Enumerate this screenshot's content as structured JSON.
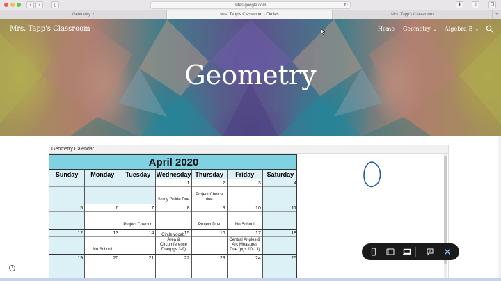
{
  "browser": {
    "url": "sites.google.com",
    "tabs": [
      "Geometry 2",
      "Mrs. Tapp's Classroom - Circles",
      "Mrs. Tapp's Classroom"
    ],
    "new_tab": "+"
  },
  "site": {
    "title": "Mrs. Tapp's Classroom",
    "nav": {
      "home": "Home",
      "geometry": "Geometry",
      "algebra": "Algebra B"
    },
    "hero_title": "Geometry"
  },
  "embed": {
    "title": "Geometry Calendar"
  },
  "calendar": {
    "month": "April 2020",
    "days": [
      "Sunday",
      "Monday",
      "Tuesday",
      "Wednesday",
      "Thursday",
      "Friday",
      "Saturday"
    ],
    "weeks": [
      [
        {
          "n": "",
          "e": ""
        },
        {
          "n": "",
          "e": ""
        },
        {
          "n": "",
          "e": ""
        },
        {
          "n": "1",
          "e": "Study Guide Due"
        },
        {
          "n": "2",
          "e": "Project Choice due"
        },
        {
          "n": "3",
          "e": ""
        },
        {
          "n": "4",
          "e": ""
        }
      ],
      [
        {
          "n": "5",
          "e": ""
        },
        {
          "n": "6",
          "e": ""
        },
        {
          "n": "7",
          "e": "Project Checkin"
        },
        {
          "n": "8",
          "e": ""
        },
        {
          "n": "9",
          "e": "Project Due"
        },
        {
          "n": "10",
          "e": "No School"
        },
        {
          "n": "11",
          "e": ""
        }
      ],
      [
        {
          "n": "12",
          "e": ""
        },
        {
          "n": "13",
          "e": "No School"
        },
        {
          "n": "14",
          "e": ""
        },
        {
          "n": "15",
          "e": "Circle vocab, Area & Circumference Due(pgs 3-9)"
        },
        {
          "n": "16",
          "e": ""
        },
        {
          "n": "17",
          "e": "Central Angles & Arc Measures Due (pgs 10-13)"
        },
        {
          "n": "18",
          "e": ""
        }
      ],
      [
        {
          "n": "19",
          "e": ""
        },
        {
          "n": "20",
          "e": ""
        },
        {
          "n": "21",
          "e": ""
        },
        {
          "n": "22",
          "e": ""
        },
        {
          "n": "23",
          "e": ""
        },
        {
          "n": "24",
          "e": ""
        },
        {
          "n": "25",
          "e": ""
        }
      ]
    ]
  },
  "colors": {
    "calendar_header": "#7fd2e2",
    "weekend": "#dcf1f6",
    "ink": "#1f5fa8",
    "toolbar": "#1a1a1a"
  },
  "icons": [
    "search-icon",
    "chevron-down-icon",
    "phone-icon",
    "tablet-icon",
    "laptop-icon",
    "comment-icon",
    "close-icon",
    "info-icon",
    "handwritten-zero"
  ]
}
